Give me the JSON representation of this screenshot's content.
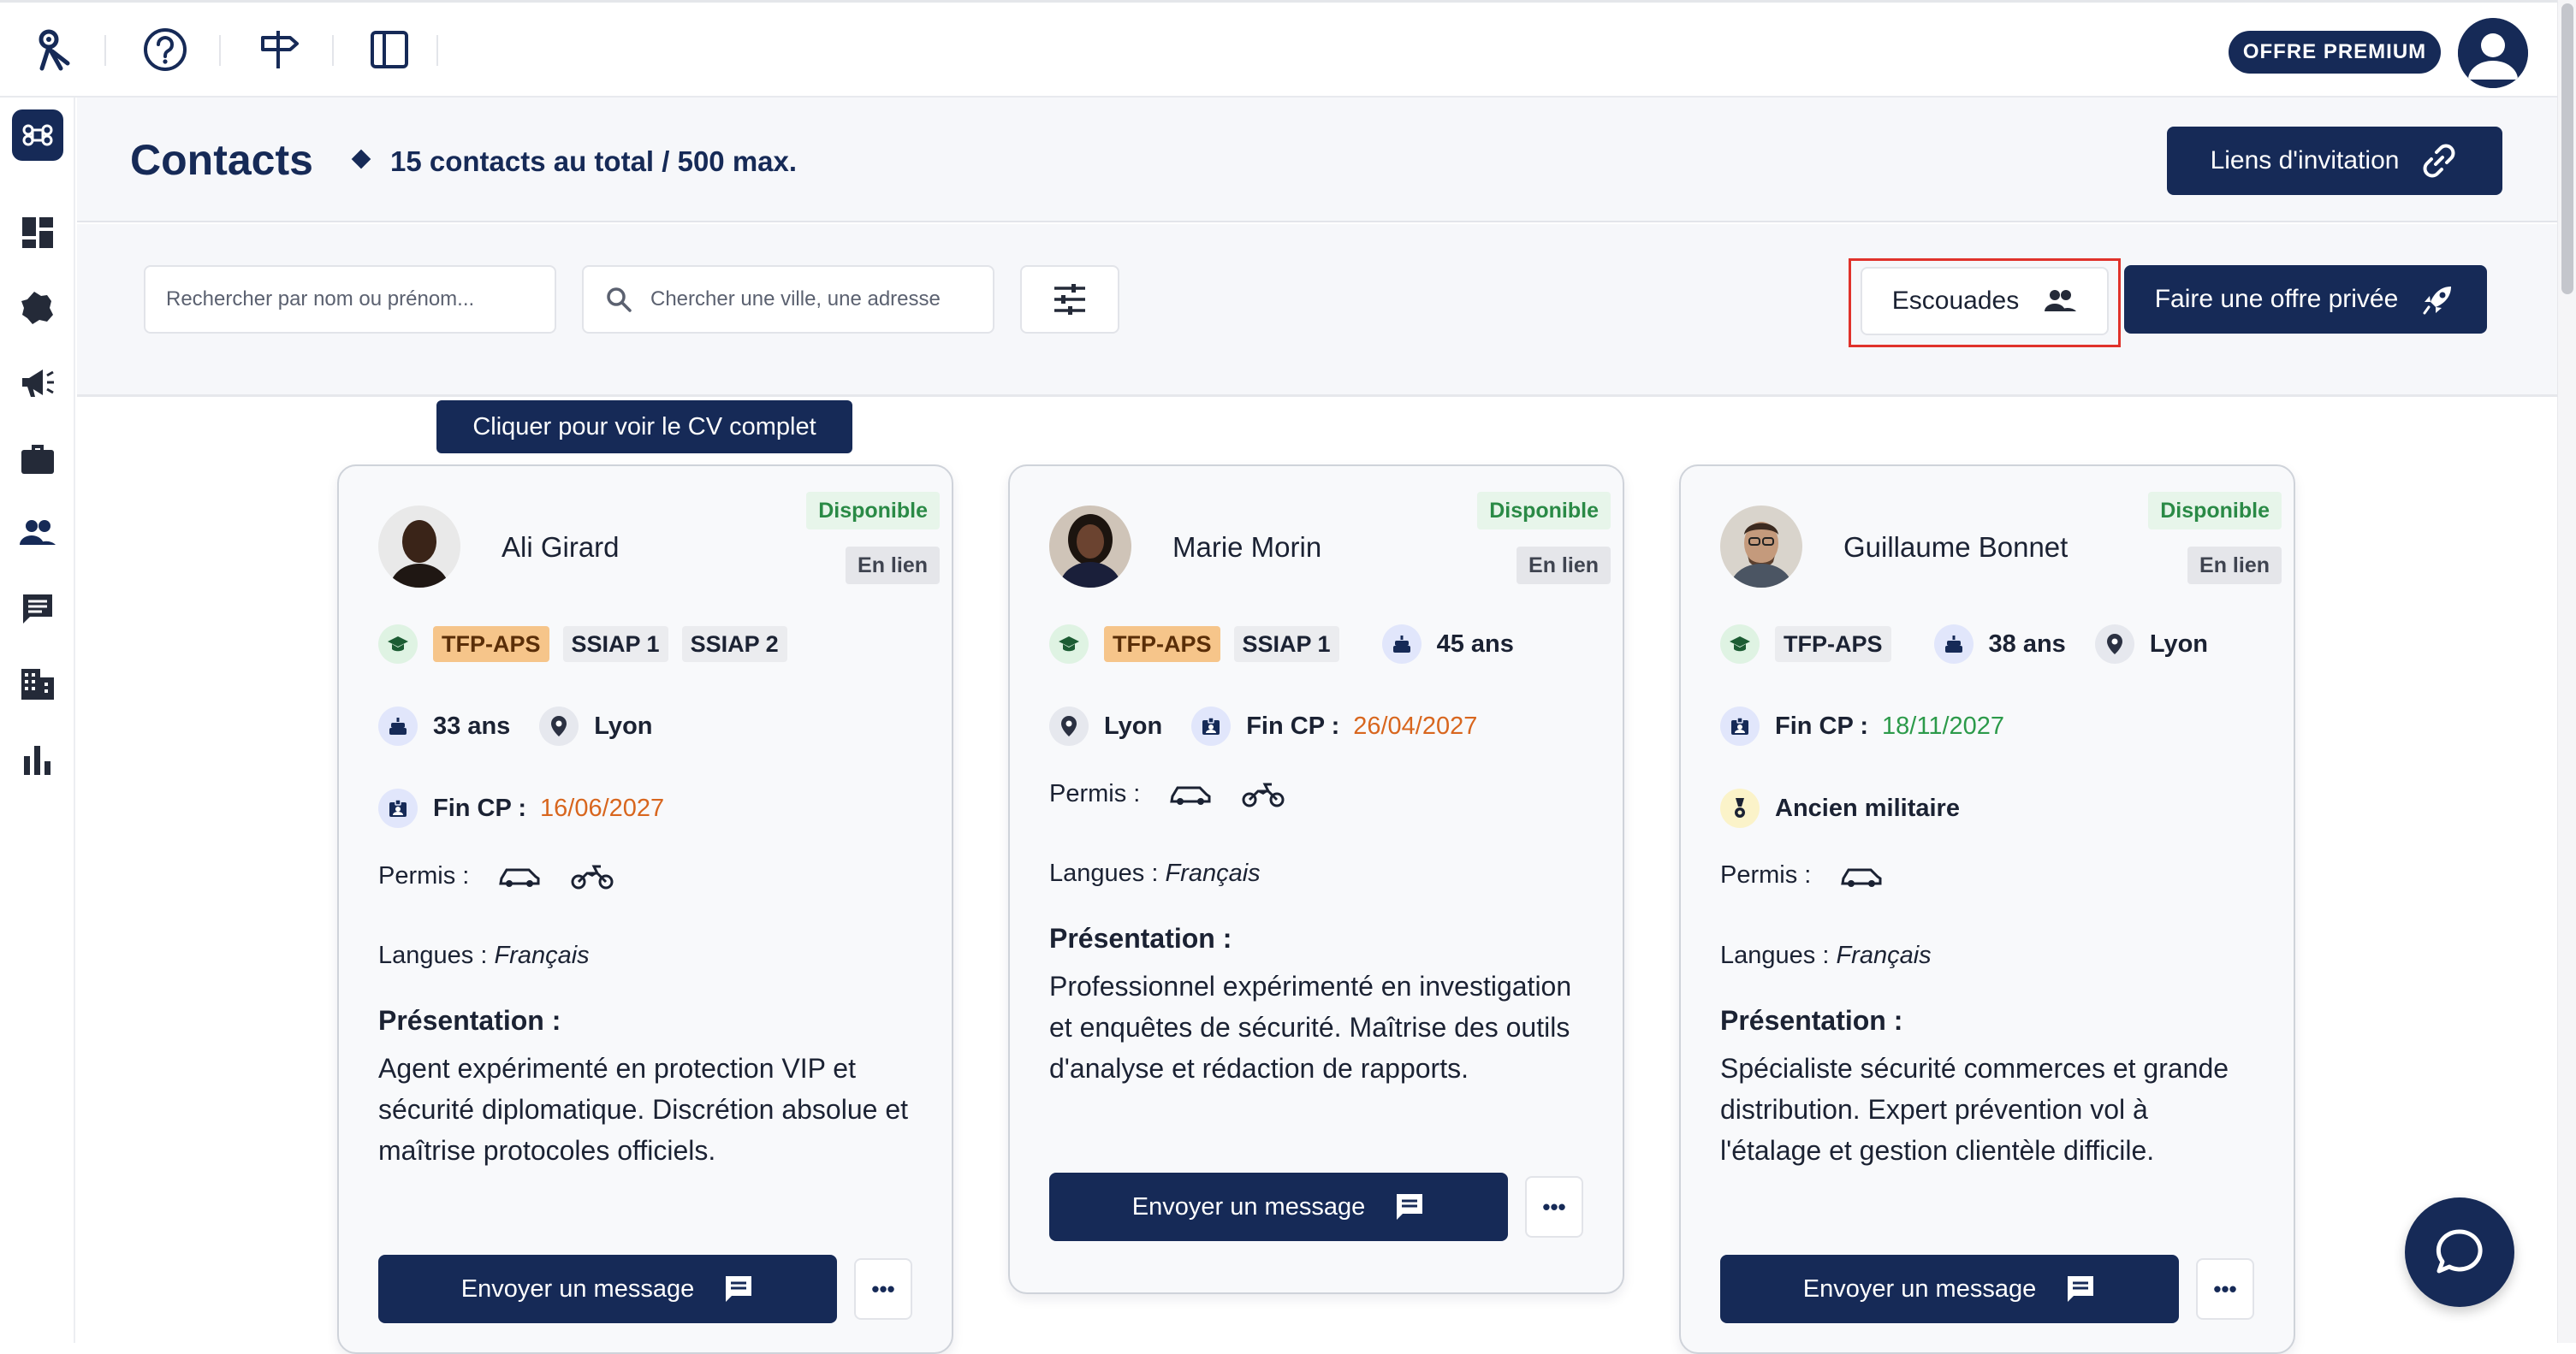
{
  "topbar": {
    "icons": [
      "logo-icon",
      "help-icon",
      "signpost-icon",
      "sidebar-toggle-icon"
    ],
    "premium_label": "OFFRE PREMIUM"
  },
  "sidebar": {
    "items": [
      "command-icon",
      "dashboard-icon",
      "france-map-icon",
      "megaphone-icon",
      "briefcase-icon",
      "contacts-icon",
      "messages-icon",
      "building-icon",
      "stats-icon"
    ]
  },
  "header": {
    "title": "Contacts",
    "subtitle": "15 contacts au total / 500 max.",
    "invite_label": "Liens d'invitation"
  },
  "toolbar": {
    "name_search_placeholder": "Rechercher par nom ou prénom...",
    "city_search_placeholder": "Chercher une ville, une adresse",
    "squads_label": "Escouades",
    "private_offer_label": "Faire une offre privée"
  },
  "tooltip": "Cliquer pour voir le CV complet",
  "common": {
    "available": "Disponible",
    "linked": "En lien",
    "permis_label": "Permis :",
    "langues_label": "Langues :",
    "fin_cp_label": "Fin CP :",
    "presentation_label": "Présentation :",
    "message_label": "Envoyer un message",
    "more_label": "•••"
  },
  "contacts": [
    {
      "name": "Ali Girard",
      "certifications": [
        "TFP-APS",
        "SSIAP 1",
        "SSIAP 2"
      ],
      "age": "33 ans",
      "city": "Lyon",
      "fin_cp": "16/06/2027",
      "permis": [
        "car",
        "motorcycle"
      ],
      "langues": "Français",
      "presentation": "Agent expérimenté en protection VIP et sécurité diplomatique. Discrétion absolue et maîtrise protocoles officiels."
    },
    {
      "name": "Marie Morin",
      "certifications": [
        "TFP-APS",
        "SSIAP 1"
      ],
      "age": "45 ans",
      "city": "Lyon",
      "fin_cp": "26/04/2027",
      "permis": [
        "car",
        "motorcycle"
      ],
      "langues": "Français",
      "presentation": "Professionnel expérimenté en investigation et enquêtes de sécurité. Maîtrise des outils d'analyse et rédaction de rapports."
    },
    {
      "name": "Guillaume Bonnet",
      "certifications": [
        "TFP-APS"
      ],
      "age": "38 ans",
      "city": "Lyon",
      "fin_cp": "18/11/2027",
      "extra": "Ancien militaire",
      "permis": [
        "car"
      ],
      "langues": "Français",
      "presentation": "Spécialiste sécurité commerces et grande distribution. Expert prévention vol à l'étalage et gestion clientèle difficile."
    }
  ],
  "colors": {
    "navy": "#162a57",
    "highlight": "#e0322b",
    "available": "#2a8a46",
    "date_warning": "#d8661e",
    "date_ok": "#2c9a4a"
  }
}
